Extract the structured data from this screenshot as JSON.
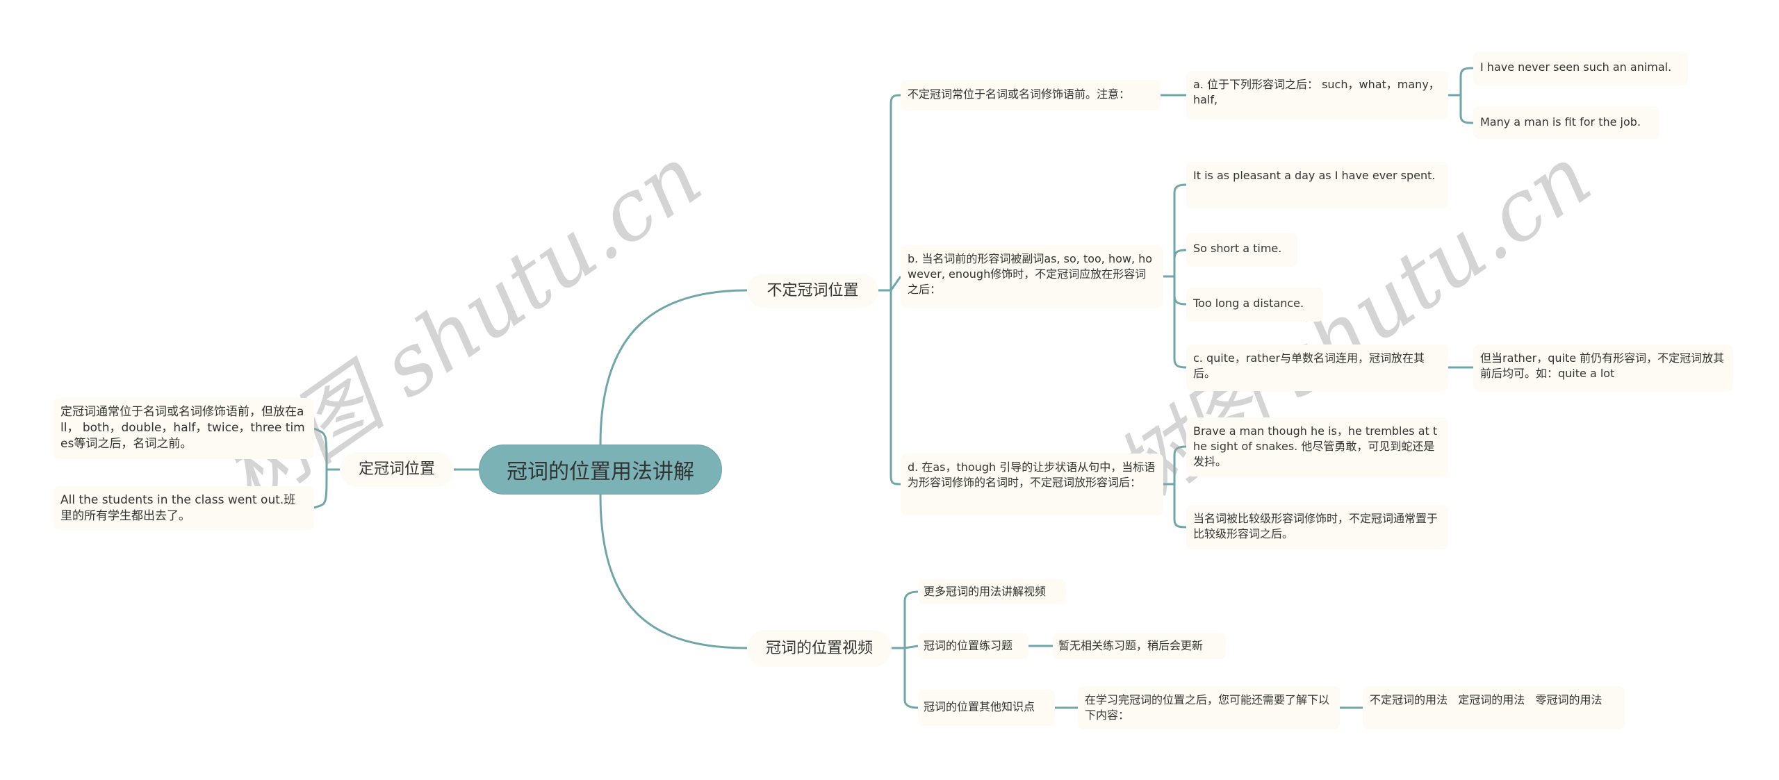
{
  "colors": {
    "root_fill": "#7bb2b5",
    "node_fill": "#fdfbf3",
    "link": "#6fa6a9",
    "text": "#333333"
  },
  "watermark": {
    "text_left": "树图 shutu.cn",
    "text_right": "树图 shutu.cn"
  },
  "root": {
    "label": "冠词的位置用法讲解"
  },
  "left": {
    "label": "定冠词位置",
    "children": [
      "定冠词通常位于名词或名词修饰语前，但放在all， both，double，half，twice，three times等词之后，名词之前。",
      "All the students in the class went out.班里的所有学生都出去了。"
    ]
  },
  "indefinite": {
    "label": "不定冠词位置",
    "note": {
      "label": "不定冠词常位于名词或名词修饰语前。注意：",
      "a": {
        "label": "a. 位于下列形容词之后： such，what，many，half,",
        "examples": [
          "I have never seen such an animal.",
          "Many a man is fit for the job."
        ]
      }
    },
    "b": {
      "label": "b. 当名词前的形容词被副词as, so, too, how, however, enough修饰时，不定冠词应放在形容词之后：",
      "examples": [
        " It is as pleasant a day as I have ever spent.",
        " So short a time.",
        " Too long a distance."
      ],
      "c": {
        "label": "c. quite，rather与单数名词连用，冠词放在其后。",
        "child": "但当rather，quite 前仍有形容词，不定冠词放其前后均可。如：quite a lot"
      }
    },
    "d": {
      "label": "d. 在as，though 引导的让步状语从句中，当标语为形容词修饰的名词时，不定冠词放形容词后：",
      "children": [
        "Brave a man though he is，he trembles at the sight of snakes. 他尽管勇敢，可见到蛇还是发抖。",
        "当名词被比较级形容词修饰时，不定冠词通常置于比较级形容词之后。"
      ]
    }
  },
  "video": {
    "label": "冠词的位置视频",
    "more_videos": "更多冠词的用法讲解视频",
    "exercises": {
      "label": "冠词的位置练习题",
      "child": "暂无相关练习题，稍后会更新"
    },
    "other": {
      "label": "冠词的位置其他知识点",
      "child": "在学习完冠词的位置之后，您可能还需要了解下以下内容：",
      "links": "不定冠词的用法   定冠词的用法   零冠词的用法"
    }
  }
}
